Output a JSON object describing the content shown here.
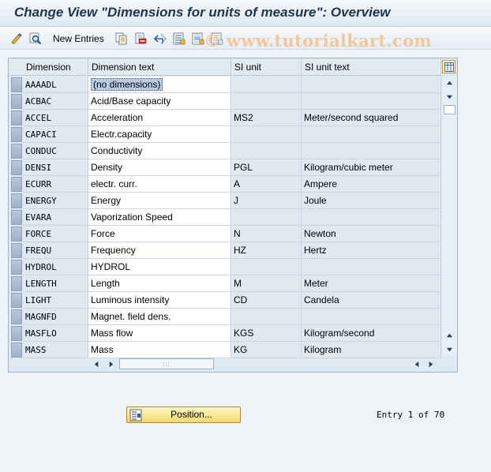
{
  "title": "Change View \"Dimensions for units of measure\": Overview",
  "toolbar": {
    "new_entries_label": "New Entries",
    "watermark": "© www.tutorialkart.com",
    "icons": [
      "display-change-icon",
      "find-icon",
      "copy-icon",
      "delete-icon",
      "undo-icon",
      "select-all-icon",
      "select-block-icon",
      "deselect-all-icon"
    ]
  },
  "table": {
    "columns": [
      "Dimension",
      "Dimension text",
      "SI unit",
      "SI unit text"
    ],
    "rows": [
      {
        "dim": "AAAADL",
        "text": "(no dimensions)",
        "si": "",
        "si_text": ""
      },
      {
        "dim": "ACBAC",
        "text": "Acid/Base capacity",
        "si": "",
        "si_text": ""
      },
      {
        "dim": "ACCEL",
        "text": "Acceleration",
        "si": "MS2",
        "si_text": "Meter/second squared"
      },
      {
        "dim": "CAPACI",
        "text": "Electr.capacity",
        "si": "",
        "si_text": ""
      },
      {
        "dim": "CONDUC",
        "text": "Conductivity",
        "si": "",
        "si_text": ""
      },
      {
        "dim": "DENSI",
        "text": "Density",
        "si": "PGL",
        "si_text": "Kilogram/cubic meter"
      },
      {
        "dim": "ECURR",
        "text": "electr. curr.",
        "si": "A",
        "si_text": "Ampere"
      },
      {
        "dim": "ENERGY",
        "text": "Energy",
        "si": "J",
        "si_text": "Joule"
      },
      {
        "dim": "EVARA",
        "text": "Vaporization Speed",
        "si": "",
        "si_text": ""
      },
      {
        "dim": "FORCE",
        "text": "Force",
        "si": "N",
        "si_text": "Newton"
      },
      {
        "dim": "FREQU",
        "text": "Frequency",
        "si": " HZ",
        "si_text": "Hertz"
      },
      {
        "dim": "HYDROL",
        "text": "HYDROL",
        "si": "",
        "si_text": ""
      },
      {
        "dim": "LENGTH",
        "text": "Length",
        "si": "M",
        "si_text": "Meter"
      },
      {
        "dim": "LIGHT",
        "text": "Luminous intensity",
        "si": "CD",
        "si_text": "Candela"
      },
      {
        "dim": "MAGNFD",
        "text": "Magnet. field dens.",
        "si": "",
        "si_text": ""
      },
      {
        "dim": "MASFLO",
        "text": "Mass flow",
        "si": "KGS",
        "si_text": "Kilogram/second"
      },
      {
        "dim": "MASS",
        "text": "Mass",
        "si": "KG",
        "si_text": "Kilogram"
      }
    ]
  },
  "footer": {
    "position_label": "Position...",
    "entry_info": "Entry 1 of 70"
  }
}
